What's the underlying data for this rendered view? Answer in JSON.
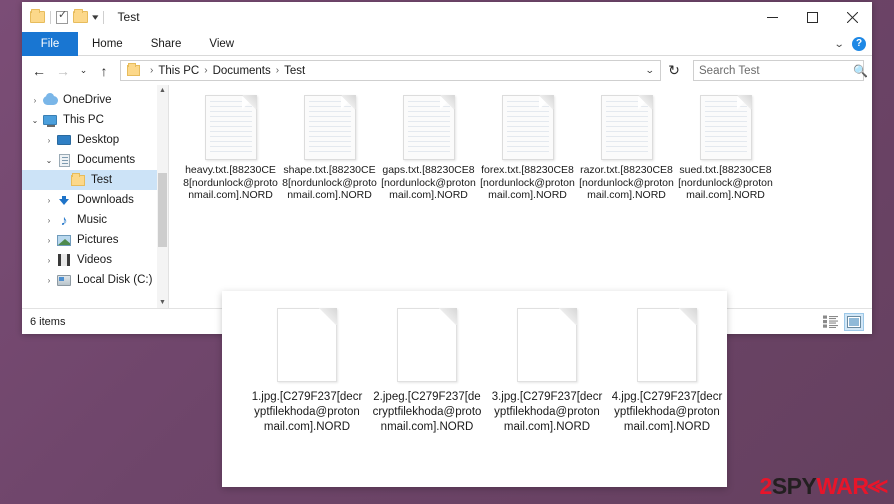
{
  "window": {
    "title": "Test",
    "quick_access": [
      {
        "name": "folder-icon",
        "label": "Folder"
      },
      {
        "name": "properties-icon",
        "label": "Properties"
      },
      {
        "name": "new-folder-icon",
        "label": "New folder"
      }
    ],
    "qat_caret": "▾",
    "controls": {
      "minimize": "Minimize",
      "maximize": "Maximize",
      "close": "Close"
    }
  },
  "ribbon": {
    "tabs": [
      {
        "label": "File",
        "active": true
      },
      {
        "label": "Home",
        "active": false
      },
      {
        "label": "Share",
        "active": false
      },
      {
        "label": "View",
        "active": false
      }
    ],
    "expand_caret": "⌄",
    "help_label": "?"
  },
  "address": {
    "back": "←",
    "forward": "→",
    "recent_caret": "⌄",
    "up": "↑",
    "breadcrumbs": [
      "This PC",
      "Documents",
      "Test"
    ],
    "separator": "›",
    "dropdown_caret": "⌄",
    "refresh": "↻"
  },
  "search": {
    "placeholder": "Search Test",
    "value": "",
    "icon": "search-icon"
  },
  "sidebar": {
    "items": [
      {
        "label": "OneDrive",
        "chevron": "›",
        "icon": "cloud-icon",
        "indent": 0,
        "selected": false
      },
      {
        "label": "This PC",
        "chevron": "⌄",
        "icon": "pc-icon",
        "indent": 0,
        "selected": false
      },
      {
        "label": "Desktop",
        "chevron": "›",
        "icon": "desktop-icon",
        "indent": 1,
        "selected": false
      },
      {
        "label": "Documents",
        "chevron": "⌄",
        "icon": "documents-icon",
        "indent": 1,
        "selected": false
      },
      {
        "label": "Test",
        "chevron": "",
        "icon": "folder-icon",
        "indent": 2,
        "selected": true
      },
      {
        "label": "Downloads",
        "chevron": "›",
        "icon": "downloads-icon",
        "indent": 1,
        "selected": false
      },
      {
        "label": "Music",
        "chevron": "›",
        "icon": "music-icon",
        "indent": 1,
        "selected": false
      },
      {
        "label": "Pictures",
        "chevron": "›",
        "icon": "pictures-icon",
        "indent": 1,
        "selected": false
      },
      {
        "label": "Videos",
        "chevron": "›",
        "icon": "videos-icon",
        "indent": 1,
        "selected": false
      },
      {
        "label": "Local Disk (C:)",
        "chevron": "›",
        "icon": "disk-icon",
        "indent": 1,
        "selected": false
      }
    ],
    "scroll_up": "▲",
    "scroll_down": "▼"
  },
  "files": [
    {
      "name": "heavy.txt.[88230CE8[nordunlock@protonmail.com].NORD",
      "icon": "text-file-icon"
    },
    {
      "name": "shape.txt.[88230CE8[nordunlock@protonmail.com].NORD",
      "icon": "text-file-icon"
    },
    {
      "name": "gaps.txt.[88230CE8[nordunlock@protonmail.com].NORD",
      "icon": "text-file-icon"
    },
    {
      "name": "forex.txt.[88230CE8[nordunlock@protonmail.com].NORD",
      "icon": "text-file-icon"
    },
    {
      "name": "razor.txt.[88230CE8[nordunlock@protonmail.com].NORD",
      "icon": "text-file-icon"
    },
    {
      "name": "sued.txt.[88230CE8[nordunlock@protonmail.com].NORD",
      "icon": "text-file-icon"
    }
  ],
  "status": {
    "item_count": "6 items",
    "view_details": "details-view-icon",
    "view_large_icons": "large-icons-view-icon"
  },
  "overlay_files": [
    {
      "name": "1.jpg.[C279F237[decryptfilekhoda@protonmail.com].NORD",
      "icon": "blank-file-icon"
    },
    {
      "name": "2.jpeg.[C279F237[decryptfilekhoda@protonmail.com].NORD",
      "icon": "blank-file-icon"
    },
    {
      "name": "3.jpg.[C279F237[decryptfilekhoda@protonmail.com].NORD",
      "icon": "blank-file-icon"
    },
    {
      "name": "4.jpg.[C279F237[decryptfilekhoda@protonmail.com].NORD",
      "icon": "blank-file-icon"
    }
  ],
  "watermark": {
    "part1": "2",
    "part2": "SPY",
    "part3": "WAR",
    "chevron": "≪"
  },
  "colors": {
    "desktop": "#70456b",
    "file_tab": "#1976d2",
    "selection": "#cce3f7",
    "watermark_red": "#e8152a",
    "watermark_dark": "#231f20"
  }
}
